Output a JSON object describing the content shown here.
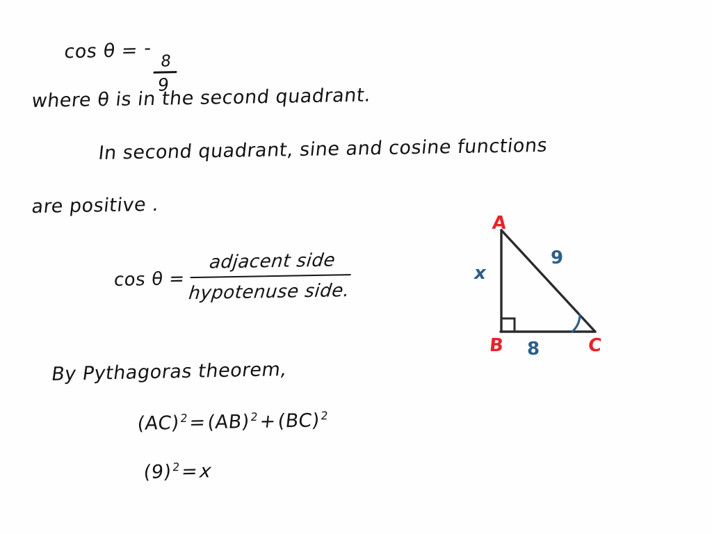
{
  "document": {
    "type": "handwritten-math-solution",
    "background_color": "#fefefe",
    "ink_color": "#141414",
    "vertex_label_color": "#e8232a",
    "side_label_color": "#2c5f8a"
  },
  "lines": {
    "cos_value": {
      "lead": "cos θ  =",
      "sign": "-",
      "numerator": "8",
      "denominator": "9"
    },
    "where_theta": "where  θ  is  in  the  second  quadrant.",
    "in_second_quadrant": "In  second  quadrant,  sine  and  cosine  functions",
    "are_positive": "are  positive .",
    "cos_definition": {
      "lhs": "cos θ  =",
      "numerator": "adjacent side",
      "denominator": "hypotenuse side."
    },
    "pythagoras_intro": "By Pythagoras theorem,",
    "equation_1": {
      "left": "(AC)",
      "left_exp": "2",
      "eq": "=",
      "mid": "(AB)",
      "mid_exp": "2",
      "plus": "+",
      "right": "(BC)",
      "right_exp": "2"
    },
    "equation_2": {
      "left": "(9)",
      "left_exp": "2",
      "eq": "=",
      "right": "x"
    }
  },
  "figure": {
    "name": "right-triangle-abc",
    "vertices": {
      "a": "A",
      "b": "B",
      "c": "C"
    },
    "sides": {
      "ab": "x",
      "ac": "9",
      "bc": "8"
    },
    "right_angle_at": "B",
    "marked_angle_at": "C"
  }
}
